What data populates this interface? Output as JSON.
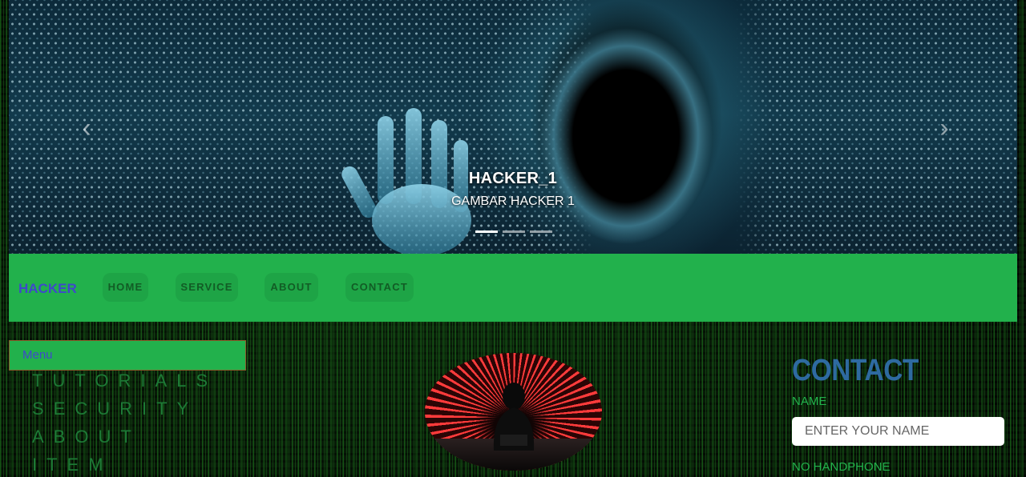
{
  "carousel": {
    "slide_title": "HACKER_1",
    "slide_subtitle": "GAMBAR HACKER 1",
    "prev_icon": "chevron-left-icon",
    "next_icon": "chevron-right-icon",
    "prev_glyph": "‹",
    "next_glyph": "›",
    "slide_count": 3,
    "active_slide": 1
  },
  "navbar": {
    "brand": "HACKER",
    "items": [
      {
        "label": "HOME"
      },
      {
        "label": "SERVICE"
      },
      {
        "label": "ABOUT"
      },
      {
        "label": "CONTACT"
      }
    ],
    "background": "#22b14c",
    "brand_color": "#3f48cc"
  },
  "sidebar": {
    "menu_label": "Menu",
    "items": [
      {
        "label": "TUTORIALS"
      },
      {
        "label": "SECURITY"
      },
      {
        "label": "ABOUT"
      },
      {
        "label": "ITEM"
      }
    ]
  },
  "contact": {
    "title": "CONTACT",
    "name_label": "NAME",
    "name_placeholder": "ENTER YOUR NAME",
    "phone_label": "NO HANDPHONE",
    "title_color": "#2e6aa0",
    "label_color": "#22b14c"
  }
}
